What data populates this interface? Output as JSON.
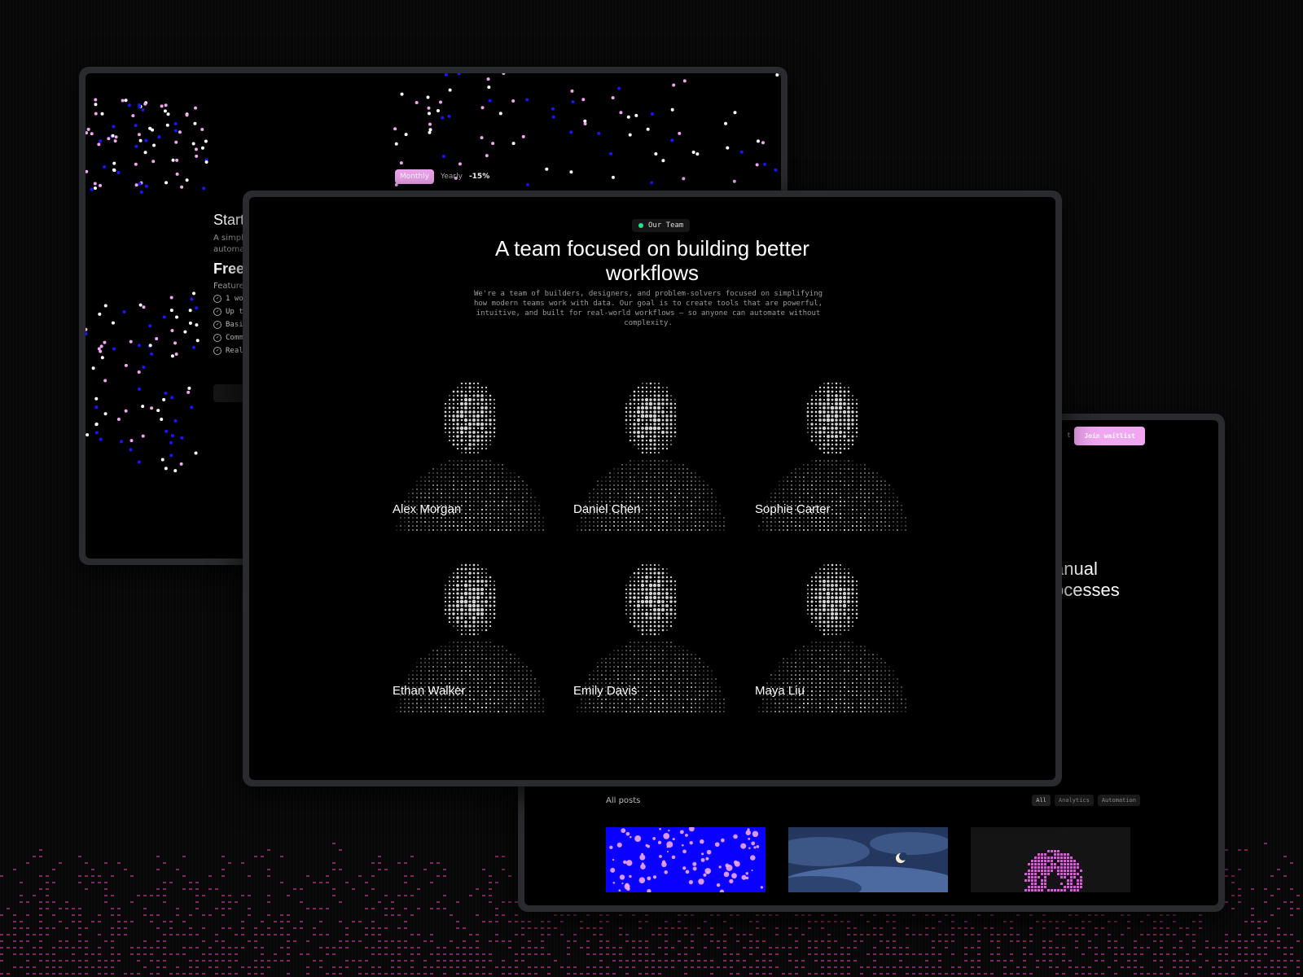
{
  "pricing": {
    "toggle_monthly": "Monthly",
    "toggle_yearly": "Yearly",
    "discount": "-15%",
    "title_fragment": "Start",
    "desc_fragment_1": "A simple",
    "desc_fragment_2": "automat",
    "plan_fragment": "Free",
    "features_label": "Features",
    "features": [
      "1 wo",
      "Up t",
      "Basi",
      "Comm",
      "Real-"
    ]
  },
  "team": {
    "tag": "Our Team",
    "title": "A team focused on building better workflows",
    "description": "We're a team of builders, designers, and problem-solvers focused on simplifying how modern teams work with data.  Our goal is to create tools that are powerful, intuitive, and built for real-world workflows — so anyone can automate without complexity.",
    "members": [
      {
        "name": "Alex Morgan"
      },
      {
        "name": "Daniel Chen"
      },
      {
        "name": "Sophie Carter"
      },
      {
        "name": "Ethan Walker"
      },
      {
        "name": "Emily Davis"
      },
      {
        "name": "Maya Liu"
      }
    ]
  },
  "blog": {
    "nav_fragment": "t",
    "cta": "Join waitlist",
    "hero_line1": "anual",
    "hero_line2": "ocesses",
    "all_posts": "All posts",
    "filters": [
      "All",
      "Analytics",
      "Automation"
    ]
  },
  "colors": {
    "accent_pink": "#f0a6f0",
    "status_green": "#27e08d",
    "thumb_blue": "#0a00ff"
  }
}
